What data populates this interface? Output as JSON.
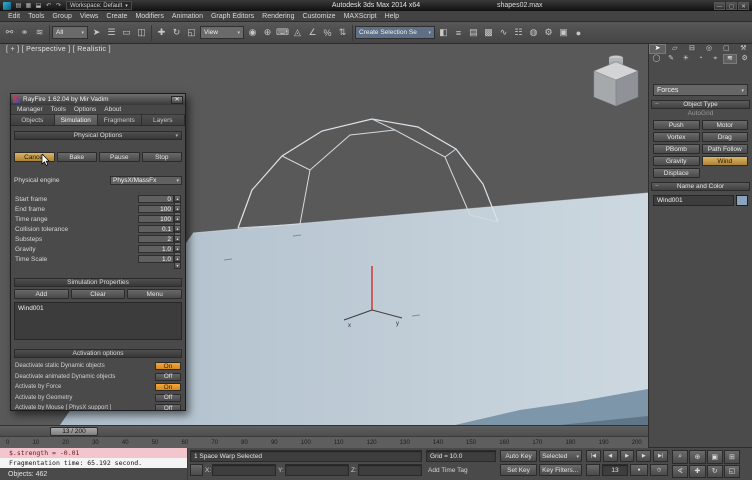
{
  "colors": {
    "accent_on": "#e8992b",
    "active_button": "#c9a452",
    "ground": "#bfccd6",
    "viewport_bg": "#595959",
    "listener_pink": "#f3c6ce"
  },
  "titlebar": {
    "qat_icons": [
      {
        "name": "new-scene-icon",
        "glyph": "▤"
      },
      {
        "name": "open-file-icon",
        "glyph": "▦"
      },
      {
        "name": "save-file-icon",
        "glyph": "⬓"
      },
      {
        "name": "undo-icon",
        "glyph": "↶"
      },
      {
        "name": "redo-icon",
        "glyph": "↷"
      }
    ],
    "workspace_label": "Workspace: Default",
    "app_title": "Autodesk 3ds Max 2014 x64",
    "doc_name": "shapes02.max",
    "window_buttons": [
      {
        "name": "minimize-button",
        "glyph": "—"
      },
      {
        "name": "maximize-button",
        "glyph": "▢"
      },
      {
        "name": "close-button",
        "glyph": "✕"
      }
    ]
  },
  "menu": {
    "items": [
      "Edit",
      "Tools",
      "Group",
      "Views",
      "Create",
      "Modifiers",
      "Animation",
      "Graph Editors",
      "Rendering",
      "Customize",
      "MAXScript",
      "Help"
    ]
  },
  "toolbar": {
    "group1": [
      {
        "name": "select-and-link-icon",
        "glyph": "⚯"
      },
      {
        "name": "unlink-selection-icon",
        "glyph": "⚭"
      },
      {
        "name": "bind-to-space-warp-icon",
        "glyph": "≋"
      }
    ],
    "selection_filter_value": "All",
    "group2": [
      {
        "name": "select-object-icon",
        "glyph": "➤"
      },
      {
        "name": "select-by-name-icon",
        "glyph": "☰"
      },
      {
        "name": "rectangular-selection-region-icon",
        "glyph": "▭"
      },
      {
        "name": "window-crossing-icon",
        "glyph": "◫"
      }
    ],
    "group3": [
      {
        "name": "select-and-move-icon",
        "glyph": "✚"
      },
      {
        "name": "select-and-rotate-icon",
        "glyph": "↻"
      },
      {
        "name": "select-and-scale-icon",
        "glyph": "◱"
      }
    ],
    "view_value": "View",
    "group4": [
      {
        "name": "use-pivot-point-center-icon",
        "glyph": "◉"
      },
      {
        "name": "select-and-manipulate-icon",
        "glyph": "⊕"
      },
      {
        "name": "keyboard-shortcut-override-icon",
        "glyph": "⌨"
      },
      {
        "name": "snaps-toggle-icon",
        "glyph": "◬"
      },
      {
        "name": "angle-snap-toggle-icon",
        "glyph": "∠"
      },
      {
        "name": "percent-snap-toggle-icon",
        "glyph": "%"
      },
      {
        "name": "spinner-snap-toggle-icon",
        "glyph": "⇅"
      }
    ],
    "named_selection_value": "Create Selection Se",
    "group5": [
      {
        "name": "mirror-icon",
        "glyph": "◧"
      },
      {
        "name": "align-icon",
        "glyph": "≡"
      },
      {
        "name": "layer-manager-icon",
        "glyph": "▤"
      },
      {
        "name": "graphite-ribbon-icon",
        "glyph": "▩"
      },
      {
        "name": "curve-editor-icon",
        "glyph": "∿"
      },
      {
        "name": "schematic-view-icon",
        "glyph": "☷"
      },
      {
        "name": "material-editor-icon",
        "glyph": "◍"
      },
      {
        "name": "render-setup-icon",
        "glyph": "⚙"
      },
      {
        "name": "rendered-frame-window-icon",
        "glyph": "▣"
      },
      {
        "name": "render-production-icon",
        "glyph": "●"
      }
    ]
  },
  "viewport": {
    "label": "[ + ] [ Perspective ] [ Realistic ]"
  },
  "rayfire": {
    "title": "RayFire 1.62.04  by Mir Vadim",
    "close_glyph": "✕",
    "menu": [
      "Manager",
      "Tools",
      "Options",
      "About"
    ],
    "tabs": [
      {
        "label": "Objects",
        "name": "rayfire-tab-objects"
      },
      {
        "label": "Simulation",
        "name": "rayfire-tab-simulation",
        "state": "selected"
      },
      {
        "label": "Fragments",
        "name": "rayfire-tab-fragments"
      },
      {
        "label": "Layers",
        "name": "rayfire-tab-layers"
      }
    ],
    "physical_options": {
      "header": "Physical Options",
      "buttons": [
        {
          "label": "Cancel",
          "name": "cancel-button",
          "state": "active"
        },
        {
          "label": "Bake",
          "name": "bake-button"
        },
        {
          "label": "Pause",
          "name": "pause-button"
        },
        {
          "label": "Stop",
          "name": "stop-button"
        }
      ],
      "engine_label": "Physical engine",
      "engine_value": "PhysX/MassFx",
      "params": [
        {
          "label": "Start frame",
          "value": "0"
        },
        {
          "label": "End frame",
          "value": "100"
        },
        {
          "label": "Time range",
          "value": "100"
        },
        {
          "label": "Collision tolerance",
          "value": "0.1"
        },
        {
          "label": "Substeps",
          "value": "2"
        },
        {
          "label": "Gravity",
          "value": "1.0"
        },
        {
          "label": "Time Scale",
          "value": "1.0"
        }
      ]
    },
    "simulation_properties": {
      "header": "Simulation Properties",
      "buttons": [
        {
          "label": "Add",
          "name": "add-button"
        },
        {
          "label": "Clear",
          "name": "clear-button"
        },
        {
          "label": "Menu",
          "name": "menu-button"
        }
      ],
      "list_items": [
        "Wind001"
      ]
    },
    "activation": {
      "header": "Activation options",
      "rows": [
        {
          "label": "Deactivate static Dynamic objects",
          "toggle": "On",
          "state": "on"
        },
        {
          "label": "Deactivate animated Dynamic objects",
          "toggle": "Off",
          "state": "off"
        },
        {
          "label": "Activate by Force",
          "toggle": "On",
          "state": "on"
        },
        {
          "label": "Activate by Geometry",
          "toggle": "Off",
          "state": "off"
        },
        {
          "label": "Activate by Mouse [ PhysX support ]",
          "toggle": "Off",
          "state": "off"
        }
      ]
    }
  },
  "cmdpanel": {
    "panel_tabs": [
      {
        "name": "create-tab-icon",
        "glyph": "➤",
        "state": "selected"
      },
      {
        "name": "modify-tab-icon",
        "glyph": "▱"
      },
      {
        "name": "hierarchy-tab-icon",
        "glyph": "⊟"
      },
      {
        "name": "motion-tab-icon",
        "glyph": "◎"
      },
      {
        "name": "display-tab-icon",
        "glyph": "▢"
      },
      {
        "name": "utilities-tab-icon",
        "glyph": "⚒"
      }
    ],
    "category_tabs": [
      {
        "name": "geometry-category-icon",
        "glyph": "◯"
      },
      {
        "name": "shapes-category-icon",
        "glyph": "✎"
      },
      {
        "name": "lights-category-icon",
        "glyph": "☀"
      },
      {
        "name": "cameras-category-icon",
        "glyph": "◔"
      },
      {
        "name": "helpers-category-icon",
        "glyph": "⌖"
      },
      {
        "name": "space-warps-category-icon",
        "glyph": "≋",
        "state": "selected"
      },
      {
        "name": "systems-category-icon",
        "glyph": "⚙"
      }
    ],
    "dropdown_value": "Forces",
    "object_type": {
      "header": "Object Type",
      "autogrid": "AutoGrid",
      "buttons": [
        {
          "label": "Push",
          "name": "push-button"
        },
        {
          "label": "Motor",
          "name": "motor-button"
        },
        {
          "label": "Vortex",
          "name": "vortex-button"
        },
        {
          "label": "Drag",
          "name": "drag-button"
        },
        {
          "label": "PBomb",
          "name": "pbomb-button"
        },
        {
          "label": "Path Follow",
          "name": "path-follow-button"
        },
        {
          "label": "Gravity",
          "name": "gravity-button"
        },
        {
          "label": "Wind",
          "name": "wind-button",
          "state": "active"
        },
        {
          "label": "Displace",
          "name": "displace-button"
        }
      ]
    },
    "name_color": {
      "header": "Name and Color",
      "name_value": "Wind001"
    }
  },
  "timeline": {
    "slider_label": "13 / 200",
    "ticks": [
      "0",
      "10",
      "20",
      "30",
      "40",
      "50",
      "60",
      "70",
      "80",
      "90",
      "100",
      "110",
      "120",
      "130",
      "140",
      "150",
      "160",
      "170",
      "180",
      "190",
      "200"
    ]
  },
  "statusbar": {
    "listener_line1": "$.strength = -0.01",
    "listener_line2": "Fragmentation time: 65.192 second.",
    "objects_count": "Objects: 462",
    "selection_status": "1 Space Warp Selected",
    "coords": [
      {
        "label": "X:"
      },
      {
        "label": "Y:"
      },
      {
        "label": "Z:"
      }
    ],
    "grid_label": "Grid = 10.0",
    "time_tag_label": "Add Time Tag",
    "auto_key": "Auto Key",
    "selected_dd": "Selected",
    "set_key": "Set Key",
    "key_filters": "Key Filters...",
    "frame_value": "13",
    "transport_row1": [
      {
        "name": "go-to-start-button",
        "glyph": "|◀"
      },
      {
        "name": "previous-frame-button",
        "glyph": "◀"
      },
      {
        "name": "play-button",
        "glyph": "▶"
      },
      {
        "name": "next-frame-button",
        "glyph": "▶"
      },
      {
        "name": "go-to-end-button",
        "glyph": "▶|"
      }
    ],
    "transport_row2_icons": [
      {
        "name": "key-mode-toggle-button",
        "glyph": "●"
      },
      {
        "name": "time-configuration-button",
        "glyph": "◷"
      }
    ],
    "nav_icons": [
      {
        "name": "zoom-icon",
        "glyph": "⌕"
      },
      {
        "name": "zoom-all-icon",
        "glyph": "⊕"
      },
      {
        "name": "zoom-extents-icon",
        "glyph": "▣"
      },
      {
        "name": "zoom-extents-all-icon",
        "glyph": "⊞"
      },
      {
        "name": "field-of-view-icon",
        "glyph": "∢"
      },
      {
        "name": "pan-view-icon",
        "glyph": "✚"
      },
      {
        "name": "orbit-icon",
        "glyph": "↻"
      },
      {
        "name": "maximize-viewport-toggle-icon",
        "glyph": "◱"
      }
    ]
  }
}
